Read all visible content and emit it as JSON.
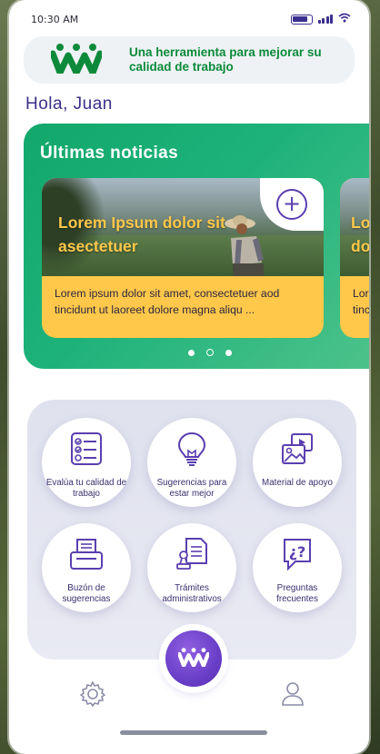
{
  "status_bar": {
    "time": "10:30 AM"
  },
  "banner": {
    "text": "Una herramienta para mejorar su calidad de trabajo",
    "logo_icon": "brand-logo-icon"
  },
  "greeting": "Hola, Juan",
  "news": {
    "title": "Últimas noticias",
    "cards": [
      {
        "headline": "Lorem Ipsum dolor sit asectetuer",
        "body": "Lorem ipsum dolor sit amet, consectetuer aod tincidunt ut laoreet dolore magna aliqu ..."
      },
      {
        "headline": "Lo do",
        "body": "Lore tinc"
      }
    ],
    "active_page": 1,
    "page_count": 3
  },
  "menu": {
    "items": [
      {
        "label": "Evalúa tu calidad de trabajo",
        "icon": "checklist-icon"
      },
      {
        "label": "Sugerencias para estar mejor",
        "icon": "lightbulb-icon"
      },
      {
        "label": "Material de apoyo",
        "icon": "media-gallery-icon"
      },
      {
        "label": "Buzón de sugerencias",
        "icon": "mailbox-icon"
      },
      {
        "label": "Trámites administrativos",
        "icon": "document-stamp-icon"
      },
      {
        "label": "Preguntas frecuentes",
        "icon": "faq-icon"
      }
    ]
  },
  "nav": {
    "left": "settings-icon",
    "center": "home-button",
    "right": "profile-icon"
  },
  "colors": {
    "brand_green": "#0c8a3a",
    "brand_purple": "#5a3fb0",
    "card_yellow": "#ffc84a",
    "news_green": "#12a86a"
  }
}
